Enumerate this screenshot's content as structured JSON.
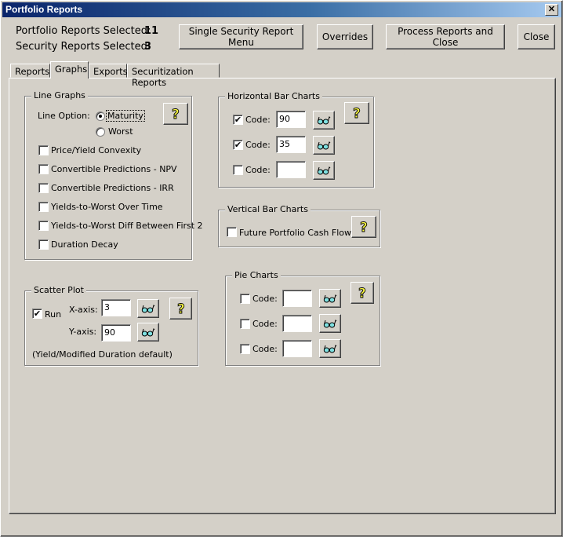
{
  "window": {
    "title": "Portfolio Reports",
    "close_glyph": "✕"
  },
  "summary": {
    "portfolio_label": "Portfolio Reports Selected:",
    "portfolio_count": "11",
    "security_label": "Security Reports Selected:",
    "security_count": "3"
  },
  "toolbar": {
    "single_security": "Single Security Report Menu",
    "overrides": "Overrides",
    "process_close": "Process Reports and Close",
    "close": "Close"
  },
  "tabs": [
    {
      "label": "Reports",
      "active": false
    },
    {
      "label": "Graphs",
      "active": true
    },
    {
      "label": "Exports",
      "active": false
    },
    {
      "label": "Securitization Reports",
      "active": false
    }
  ],
  "line_graphs": {
    "legend": "Line Graphs",
    "line_option_label": "Line Option:",
    "options": [
      {
        "label": "Maturity",
        "selected": true
      },
      {
        "label": "Worst",
        "selected": false
      }
    ],
    "checkboxes": [
      {
        "label": "Price/Yield Convexity",
        "checked": false
      },
      {
        "label": "Convertible Predictions - NPV",
        "checked": false
      },
      {
        "label": "Convertible Predictions - IRR",
        "checked": false
      },
      {
        "label": "Yields-to-Worst Over Time",
        "checked": false
      },
      {
        "label": "Yields-to-Worst Diff Between First 2",
        "checked": false
      },
      {
        "label": "Duration Decay",
        "checked": false
      }
    ]
  },
  "horizontal_bar": {
    "legend": "Horizontal Bar Charts",
    "rows": [
      {
        "label": "Code:",
        "checked": true,
        "value": "90"
      },
      {
        "label": "Code:",
        "checked": true,
        "value": "35"
      },
      {
        "label": "Code:",
        "checked": false,
        "value": ""
      }
    ]
  },
  "vertical_bar": {
    "legend": "Vertical Bar Charts",
    "checkbox": {
      "label": "Future Portfolio Cash Flows",
      "checked": false
    }
  },
  "scatter": {
    "legend": "Scatter Plot",
    "run_label": "Run",
    "run_checked": true,
    "x_label": "X-axis:",
    "x_value": "3",
    "y_label": "Y-axis:",
    "y_value": "90",
    "note": "(Yield/Modified Duration default)"
  },
  "pie": {
    "legend": "Pie Charts",
    "rows": [
      {
        "label": "Code:",
        "checked": false,
        "value": ""
      },
      {
        "label": "Code:",
        "checked": false,
        "value": ""
      },
      {
        "label": "Code:",
        "checked": false,
        "value": ""
      }
    ]
  },
  "icons": {
    "check": "✔",
    "help": "help-question-icon",
    "lookup": "glasses-lookup-icon"
  }
}
